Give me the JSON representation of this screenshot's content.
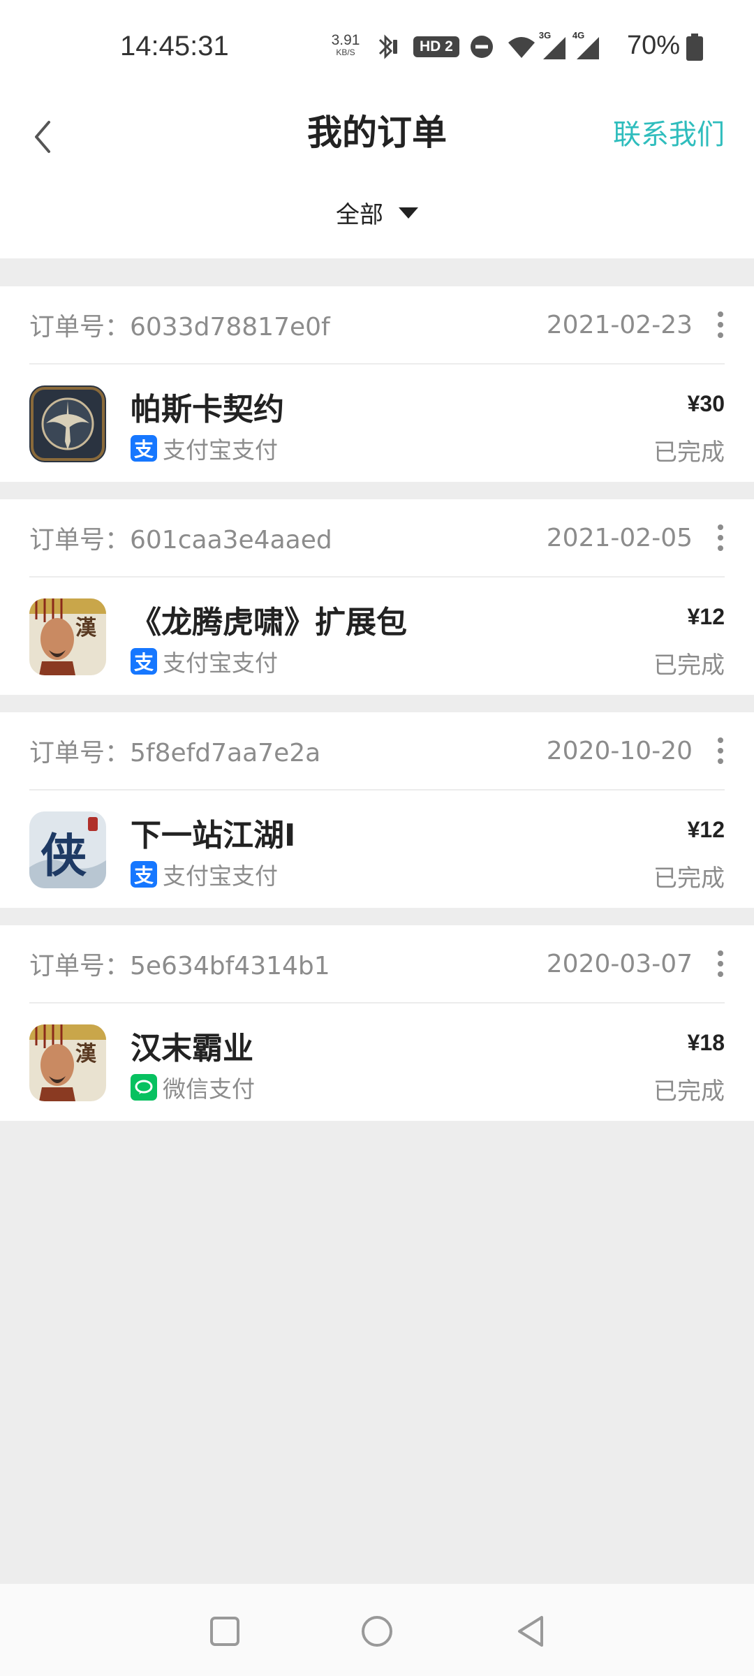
{
  "status_bar": {
    "time": "14:45:31",
    "net_speed": "3.91",
    "net_speed_unit": "KB/S",
    "hd_label": "HD 2",
    "sim1": "3G",
    "sim2": "4G",
    "battery": "70%"
  },
  "header": {
    "title": "我的订单",
    "contact_label": "联系我们",
    "filter_label": "全部"
  },
  "colors": {
    "accent": "#2fbdbd",
    "alipay": "#1677ff",
    "wechat": "#07c160"
  },
  "order_no_prefix": "订单号：",
  "orders": [
    {
      "order_no": "订单号：6033d78817e0f",
      "date": "2021-02-23",
      "game": "帕斯卡契约",
      "icon": "pascal-contract-icon",
      "pay_method": "支付宝支付",
      "pay_icon": "alipay-icon",
      "price": "¥30",
      "status": "已完成"
    },
    {
      "order_no": "订单号：601caa3e4aaed",
      "date": "2021-02-05",
      "game": "《龙腾虎啸》扩展包",
      "icon": "han-emperor-icon",
      "pay_method": "支付宝支付",
      "pay_icon": "alipay-icon",
      "price": "¥12",
      "status": "已完成"
    },
    {
      "order_no": "订单号：5f8efd7aa7e2a",
      "date": "2020-10-20",
      "game": "下一站江湖Ⅰ",
      "icon": "xia-calligraphy-icon",
      "pay_method": "支付宝支付",
      "pay_icon": "alipay-icon",
      "price": "¥12",
      "status": "已完成"
    },
    {
      "order_no": "订单号：5e634bf4314b1",
      "date": "2020-03-07",
      "game": "汉末霸业",
      "icon": "han-emperor-icon",
      "pay_method": "微信支付",
      "pay_icon": "wechat-pay-icon",
      "price": "¥18",
      "status": "已完成"
    }
  ],
  "nav": {
    "recents": "square-icon",
    "home": "circle-icon",
    "back": "triangle-back-icon"
  }
}
